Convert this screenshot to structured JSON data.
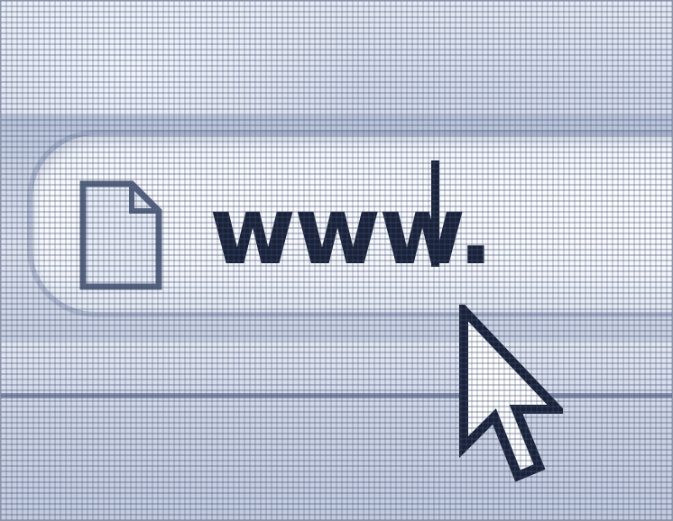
{
  "browser": {
    "address_bar": {
      "value": "www.",
      "page_icon": "document-icon",
      "caret_visible": true
    },
    "cursor": {
      "icon": "arrow-pointer-icon"
    }
  },
  "colors": {
    "text": "#1a2238",
    "address_bar_fill": "#f6f8fc",
    "background_tint": "#d4dbea",
    "grid_lines": "#3c4b6e"
  }
}
